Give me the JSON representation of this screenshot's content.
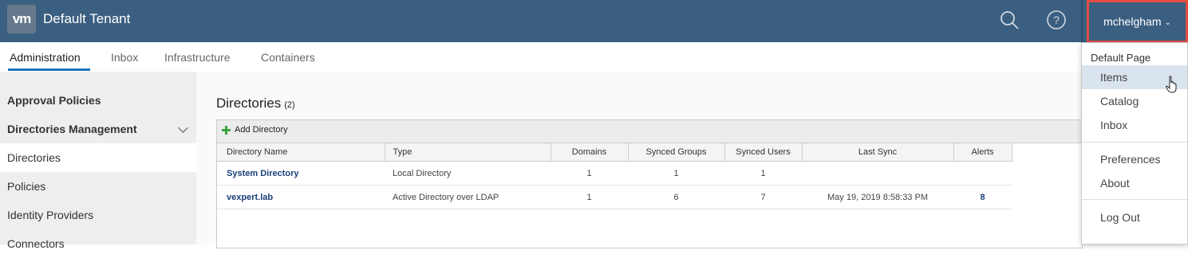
{
  "header": {
    "logo_text": "vm",
    "tenant": "Default Tenant",
    "user": "mchelgham",
    "accent": "#3b5f80"
  },
  "tabs": [
    {
      "label": "Administration",
      "active": true
    },
    {
      "label": "Inbox"
    },
    {
      "label": "Infrastructure"
    },
    {
      "label": "Containers"
    }
  ],
  "sidebar": {
    "items": [
      {
        "label": "Approval Policies"
      },
      {
        "label": "Directories Management"
      },
      {
        "label": "Directories"
      },
      {
        "label": "Policies"
      },
      {
        "label": "Identity Providers"
      },
      {
        "label": "Connectors"
      }
    ]
  },
  "main": {
    "title": "Directories",
    "count": "(2)",
    "add_label": "Add Directory",
    "columns": [
      "Directory Name",
      "Type",
      "Domains",
      "Synced Groups",
      "Synced Users",
      "Last Sync",
      "Alerts"
    ],
    "rows": [
      {
        "name": "System Directory",
        "type": "Local Directory",
        "domains": "1",
        "groups": "1",
        "users": "1",
        "last_sync": "",
        "alerts": ""
      },
      {
        "name": "vexpert.lab",
        "type": "Active Directory over LDAP",
        "domains": "1",
        "groups": "6",
        "users": "7",
        "last_sync": "May 19, 2019 8:58:33 PM",
        "alerts": "8"
      }
    ]
  },
  "dropdown": {
    "heading": "Default Page",
    "items": [
      "Items",
      "Catalog",
      "Inbox",
      "Preferences",
      "About",
      "Log Out"
    ]
  }
}
